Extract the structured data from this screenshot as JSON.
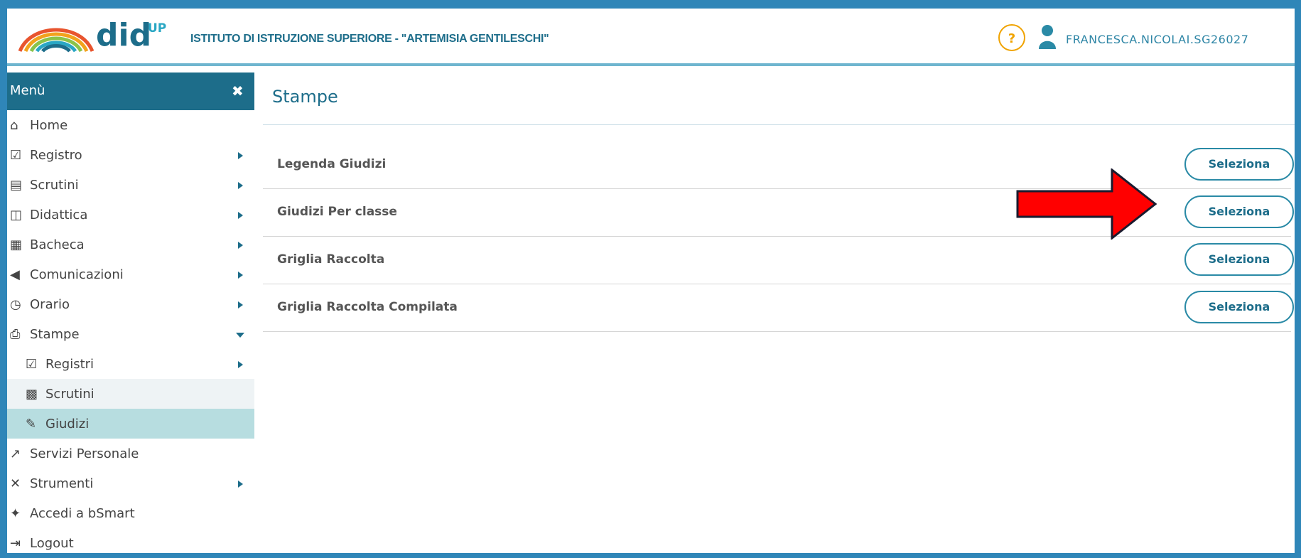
{
  "header": {
    "logo_text": "did",
    "logo_sup": "UP",
    "school_name": "ISTITUTO DI ISTRUZIONE SUPERIORE - \"ARTEMISIA GENTILESCHI\"",
    "help_label": "?",
    "username": "FRANCESCA.NICOLAI.SG26027"
  },
  "sidebar": {
    "title": "Menù",
    "close_label": "✖",
    "items": [
      {
        "label": "Home",
        "icon": "home-icon"
      },
      {
        "label": "Registro",
        "icon": "calendar-check-icon"
      },
      {
        "label": "Scrutini",
        "icon": "document-icon"
      },
      {
        "label": "Didattica",
        "icon": "book-icon"
      },
      {
        "label": "Bacheca",
        "icon": "board-icon"
      },
      {
        "label": "Comunicazioni",
        "icon": "megaphone-icon"
      },
      {
        "label": "Orario",
        "icon": "clock-icon"
      },
      {
        "label": "Stampe",
        "icon": "printer-icon"
      },
      {
        "label": "Registri",
        "icon": "calendar-check-icon"
      },
      {
        "label": "Scrutini",
        "icon": "qrcode-icon"
      },
      {
        "label": "Giudizi",
        "icon": "edit-icon"
      },
      {
        "label": "Servizi Personale",
        "icon": "share-icon"
      },
      {
        "label": "Strumenti",
        "icon": "tools-icon"
      },
      {
        "label": "Accedi a bSmart",
        "icon": "bsmart-icon"
      },
      {
        "label": "Logout",
        "icon": "logout-icon"
      }
    ]
  },
  "main": {
    "title": "Stampe",
    "rows": [
      {
        "label": "Legenda Giudizi",
        "button": "Seleziona"
      },
      {
        "label": "Giudizi Per classe",
        "button": "Seleziona"
      },
      {
        "label": "Griglia Raccolta",
        "button": "Seleziona"
      },
      {
        "label": "Griglia Raccolta Compilata",
        "button": "Seleziona"
      }
    ]
  },
  "colors": {
    "brand": "#1d6d8a",
    "frame": "#2f86b8",
    "highlight": "#b7dde0",
    "annotation_arrow": "#ff0000"
  }
}
